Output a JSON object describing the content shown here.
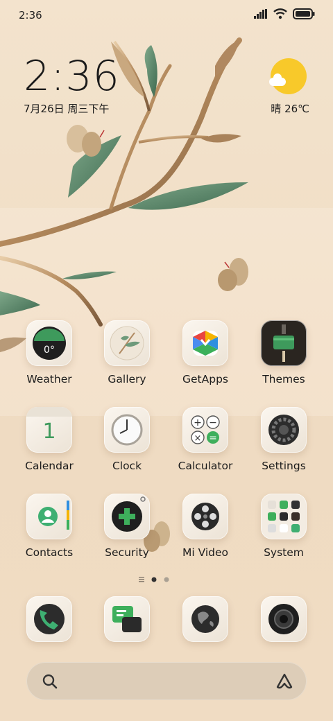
{
  "status_bar": {
    "time": "2:36"
  },
  "clock_widget": {
    "time": "2:36",
    "date": "7月26日 周三下午"
  },
  "weather_widget": {
    "text": "晴 26℃",
    "condition_icon": "sun-cloud-icon"
  },
  "apps": [
    {
      "label": "Weather"
    },
    {
      "label": "Gallery"
    },
    {
      "label": "GetApps"
    },
    {
      "label": "Themes"
    },
    {
      "label": "Calendar"
    },
    {
      "label": "Clock"
    },
    {
      "label": "Calculator"
    },
    {
      "label": "Settings"
    },
    {
      "label": "Contacts"
    },
    {
      "label": "Security"
    },
    {
      "label": "Mi Video"
    },
    {
      "label": "System"
    }
  ],
  "weather_icon_temp": "0°",
  "calendar_icon_day": "1",
  "dock": [
    {
      "icon": "phone-icon"
    },
    {
      "icon": "messages-icon"
    },
    {
      "icon": "browser-icon"
    },
    {
      "icon": "camera-icon"
    }
  ],
  "pages": {
    "count": 2,
    "current": 1
  },
  "colors": {
    "sun": "#f8c92a",
    "leaf": "#5e8a6a",
    "branch": "#c9a276",
    "background": "#f1dfc7"
  }
}
